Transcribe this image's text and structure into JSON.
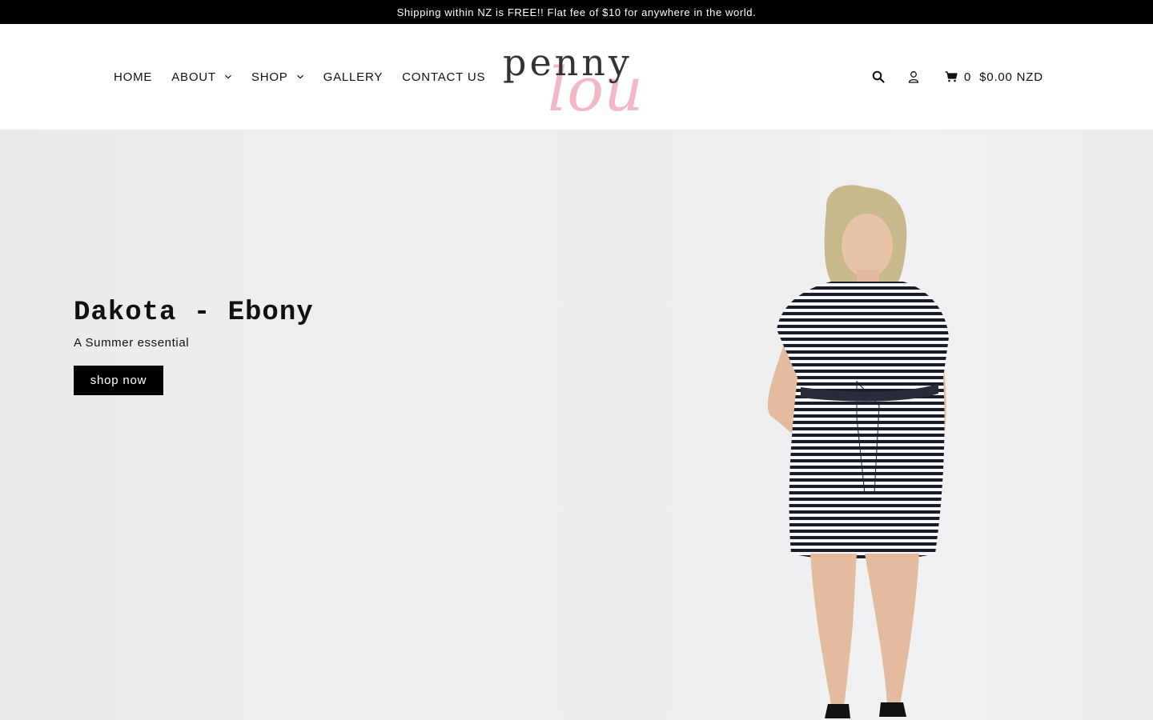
{
  "announcement": "Shipping within NZ is FREE!! Flat fee of $10 for anywhere in the world.",
  "nav": {
    "items": [
      {
        "label": "HOME"
      },
      {
        "label": "ABOUT"
      },
      {
        "label": "SHOP"
      },
      {
        "label": "GALLERY"
      },
      {
        "label": "CONTACT US"
      }
    ]
  },
  "logo": {
    "word_top": "penny",
    "word_bottom": "lou",
    "color_top": "#333333",
    "color_bottom": "#f2b8c6"
  },
  "tools": {
    "search_icon": "search-icon",
    "account_icon": "user-icon",
    "cart_icon": "cart-icon",
    "cart_count": "0",
    "cart_total": "$0.00 NZD"
  },
  "hero": {
    "title": "Dakota - Ebony",
    "subtitle": "A Summer essential",
    "button": "shop now"
  },
  "colors": {
    "bar": "#000000",
    "hero_bg": "#eceded",
    "accent_pink": "#f2b8c6"
  }
}
